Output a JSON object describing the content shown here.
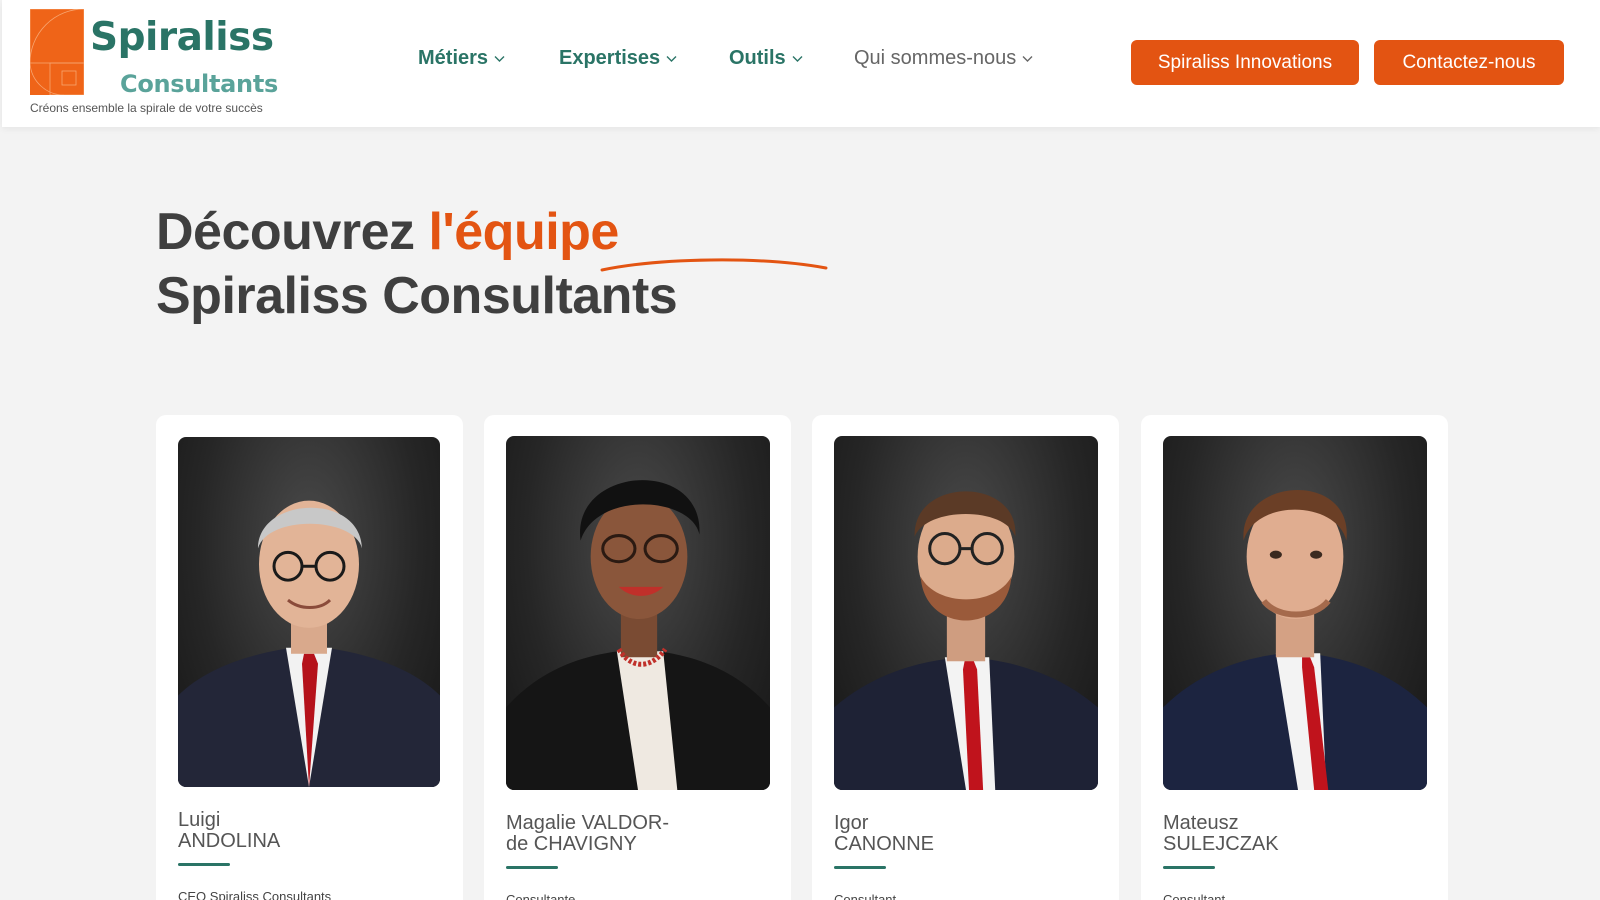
{
  "logo": {
    "name": "Spiraliss",
    "sub": "Consultants",
    "tagline": "Créons ensemble la spirale de votre succès"
  },
  "nav": [
    {
      "label": "Métiers"
    },
    {
      "label": "Expertises"
    },
    {
      "label": "Outils"
    },
    {
      "label": "Qui sommes-nous"
    }
  ],
  "buttons": {
    "innovations": "Spiraliss Innovations",
    "contact": "Contactez-nous"
  },
  "title": {
    "part1": "Découvrez ",
    "accent": "l'équipe",
    "line2": "Spiraliss Consultants"
  },
  "team": [
    {
      "first": "Luigi",
      "last": "ANDOLINA",
      "role": "CEO Spiraliss Consultants"
    },
    {
      "first": "Magalie VALDOR-",
      "last": "de CHAVIGNY",
      "role": "Consultante"
    },
    {
      "first": "Igor",
      "last": "CANONNE",
      "role": "Consultant"
    },
    {
      "first": "Mateusz",
      "last": "SULEJCZAK",
      "role": "Consultant"
    }
  ],
  "colors": {
    "brand_green": "#2a7466",
    "brand_orange": "#e35412",
    "background": "#f3f3f3"
  }
}
